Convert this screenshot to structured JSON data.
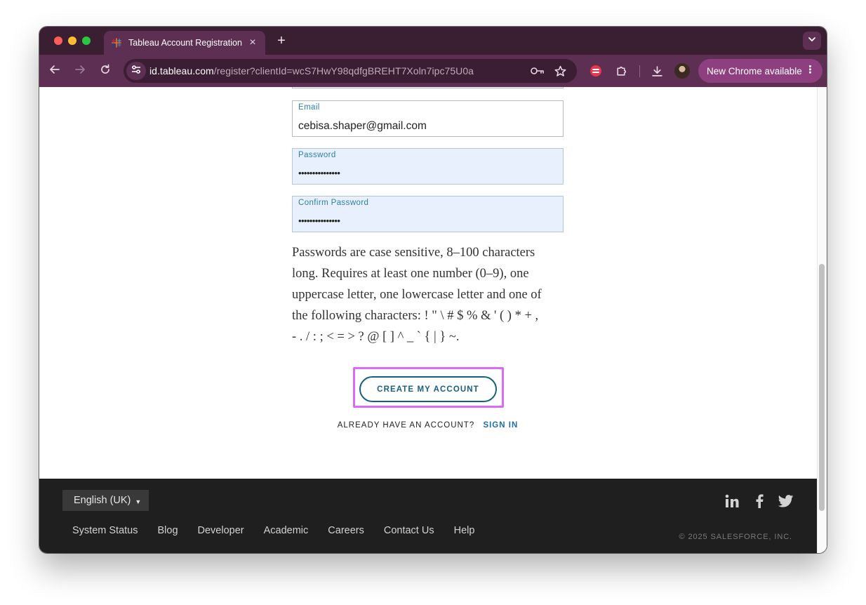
{
  "browser": {
    "tab": {
      "title": "Tableau Account Registration",
      "favicon": "tableau-logo-icon"
    },
    "url_host": "id.tableau.com",
    "url_path": "/register?clientId=wcS7HwY98qdfgBREHT7Xoln7ipc75U0a",
    "update_button": "New Chrome available"
  },
  "form": {
    "email": {
      "label": "Email",
      "value": "cebisa.shaper@gmail.com"
    },
    "password": {
      "label": "Password",
      "value": "•••••••••••••••"
    },
    "confirm_password": {
      "label": "Confirm Password",
      "value": "•••••••••••••••"
    },
    "help_lines": [
      "Passwords are case sensitive, 8–100 characters",
      "long. Requires at least one number (0–9), one",
      "uppercase letter, one lowercase letter and one of",
      "the following characters: ! \" \\ # $ % & ' ( ) * + ,",
      "- . / : ; < = > ? @ [ ] ^ _ ` { | } ~."
    ],
    "submit_label": "CREATE MY ACCOUNT",
    "signin_prompt": "ALREADY HAVE AN ACCOUNT?",
    "signin_link": "SIGN IN"
  },
  "footer": {
    "language": "English (UK)",
    "links": [
      "System Status",
      "Blog",
      "Developer",
      "Academic",
      "Careers",
      "Contact Us",
      "Help"
    ],
    "social": [
      "linkedin-icon",
      "facebook-icon",
      "twitter-icon"
    ],
    "copyright": "© 2025 SALESFORCE, INC."
  },
  "colors": {
    "browser_frame": "#5d2f53",
    "tab_strip": "#3a1f33",
    "accent_link": "#18607f",
    "highlight": "#d96bf7",
    "footer_bg": "#1f1f1f"
  }
}
